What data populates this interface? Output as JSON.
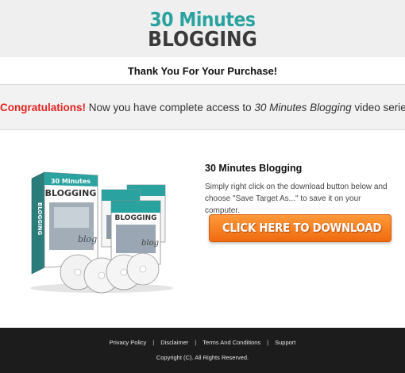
{
  "header": {
    "logo_line1": "30 Minutes",
    "logo_line2": "BLOGGING"
  },
  "thanks_text": "Thank You For Your Purchase!",
  "congrats": {
    "highlight": "Congratulations!",
    "text_before": " Now you have complete access to ",
    "product_name": "30 Minutes Blogging",
    "text_after": " video series."
  },
  "product": {
    "title": "30 Minutes Blogging",
    "description": "Simply right click on the download button below and choose \"Save Target As...\" to save it on your computer.",
    "download_label": "CLICK HERE TO DOWNLOAD",
    "box_logo_line1": "30 Minutes",
    "box_logo_line2": "BLOGGING"
  },
  "footer": {
    "links": [
      "Privacy Policy",
      "Disclaimer",
      "Terms And Conditions",
      "Support"
    ],
    "separator": "|",
    "copyright": "Copyright (C). All Rights Reserved."
  },
  "colors": {
    "accent_teal": "#2aa3a0",
    "congrats_red": "#e62020",
    "button_orange": "#f06a10",
    "footer_bg": "#1c1c1c"
  }
}
